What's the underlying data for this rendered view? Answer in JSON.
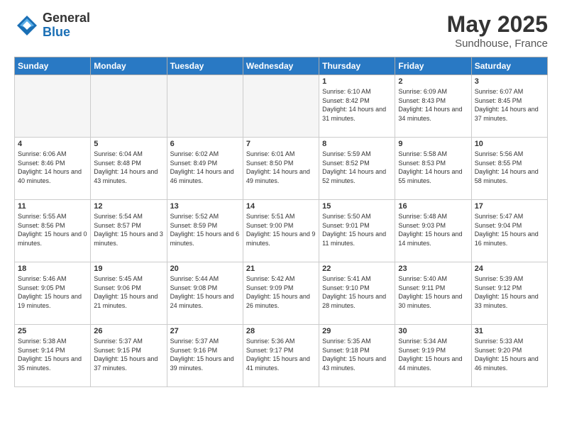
{
  "header": {
    "logo_general": "General",
    "logo_blue": "Blue",
    "title": "May 2025",
    "location": "Sundhouse, France"
  },
  "weekdays": [
    "Sunday",
    "Monday",
    "Tuesday",
    "Wednesday",
    "Thursday",
    "Friday",
    "Saturday"
  ],
  "weeks": [
    [
      {
        "day": "",
        "empty": true
      },
      {
        "day": "",
        "empty": true
      },
      {
        "day": "",
        "empty": true
      },
      {
        "day": "",
        "empty": true
      },
      {
        "day": "1",
        "sunrise": "6:10 AM",
        "sunset": "8:42 PM",
        "daylight": "14 hours and 31 minutes."
      },
      {
        "day": "2",
        "sunrise": "6:09 AM",
        "sunset": "8:43 PM",
        "daylight": "14 hours and 34 minutes."
      },
      {
        "day": "3",
        "sunrise": "6:07 AM",
        "sunset": "8:45 PM",
        "daylight": "14 hours and 37 minutes."
      }
    ],
    [
      {
        "day": "4",
        "sunrise": "6:06 AM",
        "sunset": "8:46 PM",
        "daylight": "14 hours and 40 minutes."
      },
      {
        "day": "5",
        "sunrise": "6:04 AM",
        "sunset": "8:48 PM",
        "daylight": "14 hours and 43 minutes."
      },
      {
        "day": "6",
        "sunrise": "6:02 AM",
        "sunset": "8:49 PM",
        "daylight": "14 hours and 46 minutes."
      },
      {
        "day": "7",
        "sunrise": "6:01 AM",
        "sunset": "8:50 PM",
        "daylight": "14 hours and 49 minutes."
      },
      {
        "day": "8",
        "sunrise": "5:59 AM",
        "sunset": "8:52 PM",
        "daylight": "14 hours and 52 minutes."
      },
      {
        "day": "9",
        "sunrise": "5:58 AM",
        "sunset": "8:53 PM",
        "daylight": "14 hours and 55 minutes."
      },
      {
        "day": "10",
        "sunrise": "5:56 AM",
        "sunset": "8:55 PM",
        "daylight": "14 hours and 58 minutes."
      }
    ],
    [
      {
        "day": "11",
        "sunrise": "5:55 AM",
        "sunset": "8:56 PM",
        "daylight": "15 hours and 0 minutes."
      },
      {
        "day": "12",
        "sunrise": "5:54 AM",
        "sunset": "8:57 PM",
        "daylight": "15 hours and 3 minutes."
      },
      {
        "day": "13",
        "sunrise": "5:52 AM",
        "sunset": "8:59 PM",
        "daylight": "15 hours and 6 minutes."
      },
      {
        "day": "14",
        "sunrise": "5:51 AM",
        "sunset": "9:00 PM",
        "daylight": "15 hours and 9 minutes."
      },
      {
        "day": "15",
        "sunrise": "5:50 AM",
        "sunset": "9:01 PM",
        "daylight": "15 hours and 11 minutes."
      },
      {
        "day": "16",
        "sunrise": "5:48 AM",
        "sunset": "9:03 PM",
        "daylight": "15 hours and 14 minutes."
      },
      {
        "day": "17",
        "sunrise": "5:47 AM",
        "sunset": "9:04 PM",
        "daylight": "15 hours and 16 minutes."
      }
    ],
    [
      {
        "day": "18",
        "sunrise": "5:46 AM",
        "sunset": "9:05 PM",
        "daylight": "15 hours and 19 minutes."
      },
      {
        "day": "19",
        "sunrise": "5:45 AM",
        "sunset": "9:06 PM",
        "daylight": "15 hours and 21 minutes."
      },
      {
        "day": "20",
        "sunrise": "5:44 AM",
        "sunset": "9:08 PM",
        "daylight": "15 hours and 24 minutes."
      },
      {
        "day": "21",
        "sunrise": "5:42 AM",
        "sunset": "9:09 PM",
        "daylight": "15 hours and 26 minutes."
      },
      {
        "day": "22",
        "sunrise": "5:41 AM",
        "sunset": "9:10 PM",
        "daylight": "15 hours and 28 minutes."
      },
      {
        "day": "23",
        "sunrise": "5:40 AM",
        "sunset": "9:11 PM",
        "daylight": "15 hours and 30 minutes."
      },
      {
        "day": "24",
        "sunrise": "5:39 AM",
        "sunset": "9:12 PM",
        "daylight": "15 hours and 33 minutes."
      }
    ],
    [
      {
        "day": "25",
        "sunrise": "5:38 AM",
        "sunset": "9:14 PM",
        "daylight": "15 hours and 35 minutes."
      },
      {
        "day": "26",
        "sunrise": "5:37 AM",
        "sunset": "9:15 PM",
        "daylight": "15 hours and 37 minutes."
      },
      {
        "day": "27",
        "sunrise": "5:37 AM",
        "sunset": "9:16 PM",
        "daylight": "15 hours and 39 minutes."
      },
      {
        "day": "28",
        "sunrise": "5:36 AM",
        "sunset": "9:17 PM",
        "daylight": "15 hours and 41 minutes."
      },
      {
        "day": "29",
        "sunrise": "5:35 AM",
        "sunset": "9:18 PM",
        "daylight": "15 hours and 43 minutes."
      },
      {
        "day": "30",
        "sunrise": "5:34 AM",
        "sunset": "9:19 PM",
        "daylight": "15 hours and 44 minutes."
      },
      {
        "day": "31",
        "sunrise": "5:33 AM",
        "sunset": "9:20 PM",
        "daylight": "15 hours and 46 minutes."
      }
    ]
  ]
}
